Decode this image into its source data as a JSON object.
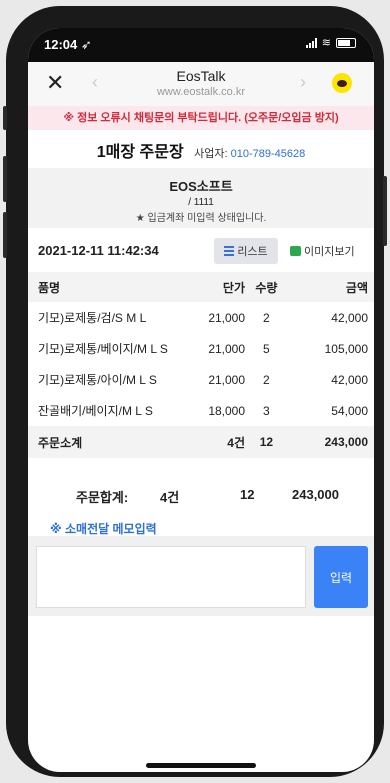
{
  "status": {
    "time": "12:04 ➶"
  },
  "browser": {
    "title": "EosTalk",
    "url": "www.eostalk.co.kr"
  },
  "notice": "※ 정보 오류시 채팅문의 부탁드립니다. (오주문/오입금 방지)",
  "order": {
    "title": "1매장 주문장",
    "biz_label": "사업자:",
    "biz_phone": "010-789-45628"
  },
  "shop": {
    "name": "EOS소프트",
    "code": "/ 1111",
    "status": "★ 입금계좌 미입력 상태입니다."
  },
  "toolbar": {
    "datetime": "2021-12-11 11:42:34",
    "list_label": "리스트",
    "image_label": "이미지보기"
  },
  "table": {
    "headers": [
      "품명",
      "단가",
      "수량",
      "금액"
    ],
    "rows": [
      [
        "기모)로제통/검/S M L",
        "21,000",
        "2",
        "42,000"
      ],
      [
        "기모)로제통/베이지/M L S",
        "21,000",
        "5",
        "105,000"
      ],
      [
        "기모)로제통/아이/M L S",
        "21,000",
        "2",
        "42,000"
      ],
      [
        "잔골배기/베이지/M L S",
        "18,000",
        "3",
        "54,000"
      ]
    ],
    "subtotal": {
      "label": "주문소계",
      "count": "4건",
      "qty": "12",
      "amount": "243,000"
    }
  },
  "total": {
    "label": "주문합계:",
    "count": "4건",
    "qty": "12",
    "amount": "243,000"
  },
  "memo": {
    "label": "※ 소매전달 메모입력",
    "button": "입력"
  },
  "colors": {
    "accent": "#3b82f6",
    "link": "#2e6fd8",
    "notice_text": "#d22a3a",
    "notice_bg": "#fce8ec"
  }
}
